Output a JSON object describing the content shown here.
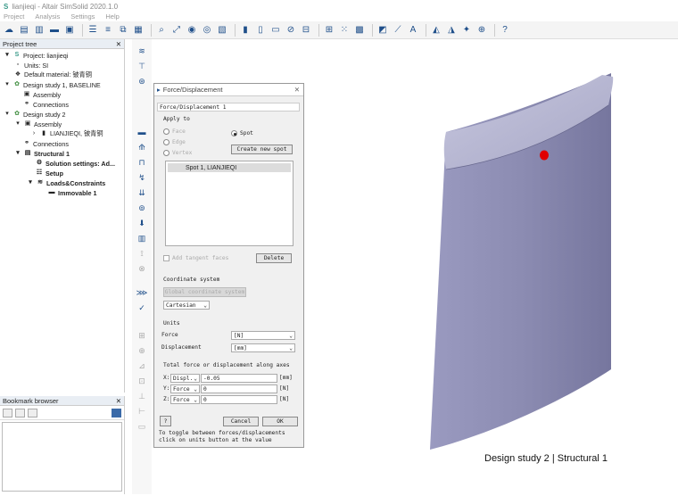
{
  "window": {
    "title": "lianjieqi - Altair SimSolid 2020.1.0"
  },
  "menu": [
    "Project",
    "Analysis",
    "Settings",
    "Help"
  ],
  "project_tree": {
    "header": "Project tree",
    "items": [
      {
        "label": "Project: lianjieqi",
        "level": 0
      },
      {
        "label": "Units: SI",
        "level": 1
      },
      {
        "label": "Default material: 铍青铜",
        "level": 1
      },
      {
        "label": "Design study 1, BASELINE",
        "level": 1
      },
      {
        "label": "Assembly",
        "level": 2
      },
      {
        "label": "Connections",
        "level": 2
      },
      {
        "label": "Design study 2",
        "level": 1
      },
      {
        "label": "Assembly",
        "level": 2
      },
      {
        "label": "LIANJIEQI, 铍青铜",
        "level": 3
      },
      {
        "label": "Connections",
        "level": 2
      },
      {
        "label": "Structural  1",
        "level": 2
      },
      {
        "label": "Solution settings: Ad...",
        "level": 3
      },
      {
        "label": "Setup",
        "level": 3
      },
      {
        "label": "Loads&Constraints",
        "level": 3
      },
      {
        "label": "Immovable 1",
        "level": 4
      }
    ]
  },
  "bookmark_browser": {
    "header": "Bookmark browser"
  },
  "dialog": {
    "title": "Force/Displacement",
    "name_value": "Force/Displacement 1",
    "apply_to_label": "Apply to",
    "face_label": "Face",
    "edge_label": "Edge",
    "vertex_label": "Vertex",
    "spot_label": "Spot",
    "create_spot_button": "Create new spot",
    "spot_list": [
      "Spot 1, LIANJIEQI"
    ],
    "add_tangent_label": "Add tangent faces",
    "delete_button": "Delete",
    "coord_system_label": "Coordinate system",
    "global_coord_button": "Global coordinate system",
    "coord_type": "Cartesian",
    "units_label": "Units",
    "force_label": "Force",
    "force_unit": "[N]",
    "displacement_label": "Displacement",
    "displacement_unit": "[mm]",
    "total_label": "Total force or displacement along axes",
    "axes": [
      {
        "axis": "X:",
        "mode": "Displ.",
        "value": "-0.05",
        "unit": "[mm]"
      },
      {
        "axis": "Y:",
        "mode": "Force",
        "value": "0",
        "unit": "[N]"
      },
      {
        "axis": "Z:",
        "mode": "Force",
        "value": "0",
        "unit": "[N]"
      }
    ],
    "help_button": "?",
    "cancel_button": "Cancel",
    "ok_button": "OK",
    "hint": "To toggle between forces/displacements click on units button at the value"
  },
  "viewport": {
    "label": "Design study 2 | Structural  1"
  },
  "colors": {
    "part": "#8c8cb0",
    "spot": "#e00000",
    "accent": "#1f4f8a"
  }
}
